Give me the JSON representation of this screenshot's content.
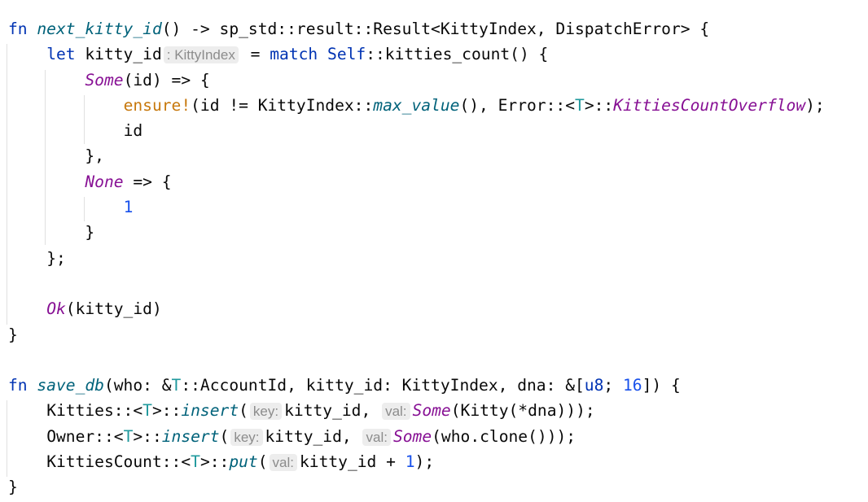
{
  "code": {
    "lines": [
      {
        "indent": 0,
        "tokens": [
          {
            "t": "fn ",
            "c": "kw"
          },
          {
            "t": "next_kitty_id",
            "c": "fn"
          },
          {
            "t": "() -> sp_std::result::Result<KittyIndex, DispatchError> {",
            "c": ""
          }
        ]
      },
      {
        "indent": 1,
        "tokens": [
          {
            "t": "let ",
            "c": "kw"
          },
          {
            "t": "kitty_id",
            "c": ""
          },
          {
            "t": ": KittyIndex",
            "c": "hint"
          },
          {
            "t": " = ",
            "c": ""
          },
          {
            "t": "match ",
            "c": "kw"
          },
          {
            "t": "Self",
            "c": "kw"
          },
          {
            "t": "::kitties_count() {",
            "c": ""
          }
        ]
      },
      {
        "indent": 2,
        "tokens": [
          {
            "t": "Some",
            "c": "en"
          },
          {
            "t": "(id) => {",
            "c": ""
          }
        ]
      },
      {
        "indent": 3,
        "tokens": [
          {
            "t": "ensure!",
            "c": "mac"
          },
          {
            "t": "(id != KittyIndex::",
            "c": ""
          },
          {
            "t": "max_value",
            "c": "fn"
          },
          {
            "t": "(), Error::<",
            "c": ""
          },
          {
            "t": "T",
            "c": "tp"
          },
          {
            "t": ">::",
            "c": ""
          },
          {
            "t": "KittiesCountOverflow",
            "c": "en"
          },
          {
            "t": ");",
            "c": ""
          }
        ]
      },
      {
        "indent": 3,
        "tokens": [
          {
            "t": "id",
            "c": ""
          }
        ]
      },
      {
        "indent": 2,
        "tokens": [
          {
            "t": "},",
            "c": ""
          }
        ]
      },
      {
        "indent": 2,
        "tokens": [
          {
            "t": "None",
            "c": "en"
          },
          {
            "t": " => {",
            "c": ""
          }
        ]
      },
      {
        "indent": 3,
        "tokens": [
          {
            "t": "1",
            "c": "num"
          }
        ]
      },
      {
        "indent": 2,
        "tokens": [
          {
            "t": "}",
            "c": ""
          }
        ]
      },
      {
        "indent": 1,
        "tokens": [
          {
            "t": "};",
            "c": ""
          }
        ]
      },
      {
        "indent": 0,
        "tokens": []
      },
      {
        "indent": 1,
        "tokens": [
          {
            "t": "Ok",
            "c": "en"
          },
          {
            "t": "(kitty_id)",
            "c": ""
          }
        ]
      },
      {
        "indent": 0,
        "tokens": [
          {
            "t": "}",
            "c": ""
          }
        ]
      },
      {
        "indent": 0,
        "tokens": []
      },
      {
        "indent": 0,
        "tokens": [
          {
            "t": "fn ",
            "c": "kw"
          },
          {
            "t": "save_db",
            "c": "fn"
          },
          {
            "t": "(who: &",
            "c": ""
          },
          {
            "t": "T",
            "c": "tp"
          },
          {
            "t": "::AccountId, kitty_id: KittyIndex, dna: &[",
            "c": ""
          },
          {
            "t": "u8",
            "c": "kw"
          },
          {
            "t": "; ",
            "c": ""
          },
          {
            "t": "16",
            "c": "num"
          },
          {
            "t": "]) {",
            "c": ""
          }
        ]
      },
      {
        "indent": 1,
        "tokens": [
          {
            "t": "Kitties::<",
            "c": ""
          },
          {
            "t": "T",
            "c": "tp"
          },
          {
            "t": ">::",
            "c": ""
          },
          {
            "t": "insert",
            "c": "fn"
          },
          {
            "t": "(",
            "c": ""
          },
          {
            "t": "key:",
            "c": "hint"
          },
          {
            "t": "kitty_id, ",
            "c": ""
          },
          {
            "t": "val:",
            "c": "hint"
          },
          {
            "t": "Some",
            "c": "en"
          },
          {
            "t": "(Kitty(*dna)));",
            "c": ""
          }
        ]
      },
      {
        "indent": 1,
        "tokens": [
          {
            "t": "Owner::<",
            "c": ""
          },
          {
            "t": "T",
            "c": "tp"
          },
          {
            "t": ">::",
            "c": ""
          },
          {
            "t": "insert",
            "c": "fn"
          },
          {
            "t": "(",
            "c": ""
          },
          {
            "t": "key:",
            "c": "hint"
          },
          {
            "t": "kitty_id, ",
            "c": ""
          },
          {
            "t": "val:",
            "c": "hint"
          },
          {
            "t": "Some",
            "c": "en"
          },
          {
            "t": "(who.clone()));",
            "c": ""
          }
        ]
      },
      {
        "indent": 1,
        "tokens": [
          {
            "t": "KittiesCount::<",
            "c": ""
          },
          {
            "t": "T",
            "c": "tp"
          },
          {
            "t": ">::",
            "c": ""
          },
          {
            "t": "put",
            "c": "fn"
          },
          {
            "t": "(",
            "c": ""
          },
          {
            "t": "val:",
            "c": "hint"
          },
          {
            "t": "kitty_id + ",
            "c": ""
          },
          {
            "t": "1",
            "c": "num"
          },
          {
            "t": ");",
            "c": ""
          }
        ]
      },
      {
        "indent": 0,
        "tokens": [
          {
            "t": "}",
            "c": ""
          }
        ]
      }
    ]
  }
}
